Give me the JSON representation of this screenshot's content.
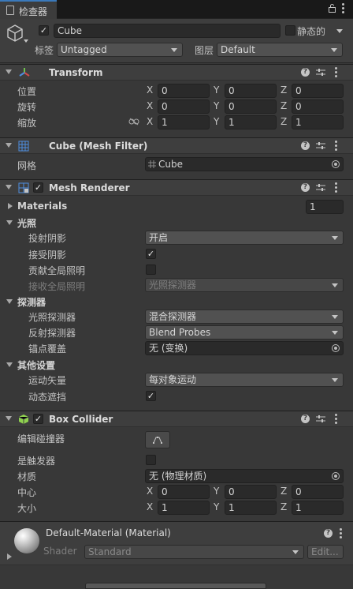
{
  "tab": {
    "title": "检查器"
  },
  "object": {
    "name": "Cube",
    "static_label": "静态的",
    "tag_label": "标签",
    "tag_value": "Untagged",
    "layer_label": "图层",
    "layer_value": "Default"
  },
  "transform": {
    "title": "Transform",
    "position": {
      "label": "位置",
      "x": "0",
      "y": "0",
      "z": "0"
    },
    "rotation": {
      "label": "旋转",
      "x": "0",
      "y": "0",
      "z": "0"
    },
    "scale": {
      "label": "缩放",
      "x": "1",
      "y": "1",
      "z": "1"
    }
  },
  "axes": {
    "x": "X",
    "y": "Y",
    "z": "Z"
  },
  "mesh_filter": {
    "title": "Cube (Mesh Filter)",
    "mesh_label": "网格",
    "mesh_value": "Cube"
  },
  "mesh_renderer": {
    "title": "Mesh Renderer",
    "materials_label": "Materials",
    "materials_count": "1",
    "lighting_header": "光照",
    "cast_shadows_label": "投射阴影",
    "cast_shadows_value": "开启",
    "receive_shadows_label": "接受阴影",
    "contribute_gi_label": "贡献全局照明",
    "receive_gi_label": "接收全局照明",
    "receive_gi_value": "光照探测器",
    "probes_header": "探测器",
    "light_probes_label": "光照探测器",
    "light_probes_value": "混合探测器",
    "reflection_probes_label": "反射探测器",
    "reflection_probes_value": "Blend Probes",
    "anchor_override_label": "锚点覆盖",
    "anchor_override_value": "无 (变换)",
    "other_header": "其他设置",
    "motion_vectors_label": "运动矢量",
    "motion_vectors_value": "每对象运动",
    "dynamic_occlusion_label": "动态遮挡"
  },
  "box_collider": {
    "title": "Box Collider",
    "edit_collider_label": "编辑碰撞器",
    "is_trigger_label": "是触发器",
    "material_label": "材质",
    "material_value": "无 (物理材质)",
    "center": {
      "label": "中心",
      "x": "0",
      "y": "0",
      "z": "0"
    },
    "size": {
      "label": "大小",
      "x": "1",
      "y": "1",
      "z": "1"
    }
  },
  "material": {
    "title": "Default-Material (Material)",
    "shader_label": "Shader",
    "shader_value": "Standard",
    "edit_label": "Edit..."
  },
  "icons": {
    "help": "?"
  },
  "colors": {
    "accent": "#3a79bb",
    "panel": "#383838",
    "header": "#3e3e3e"
  }
}
